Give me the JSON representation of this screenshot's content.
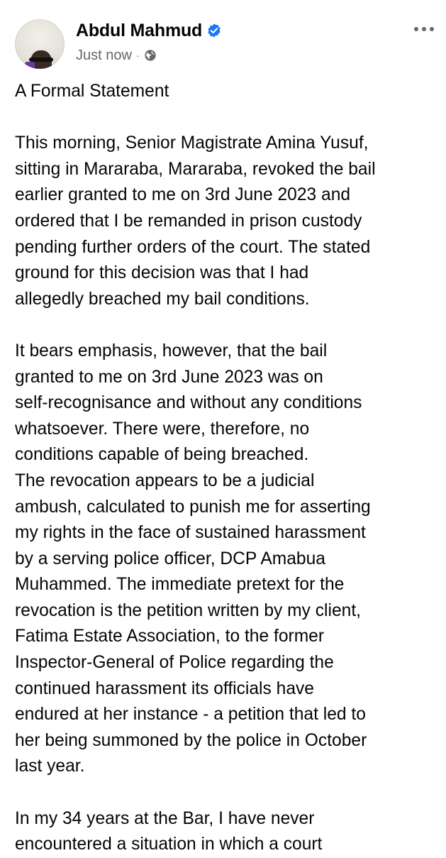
{
  "post": {
    "author": {
      "name": "Abdul Mahmud",
      "verified": true,
      "verified_icon": "verified-badge-icon",
      "verified_color": "#1877f2"
    },
    "meta": {
      "time": "Just now",
      "separator": "·",
      "audience_icon": "globe-icon"
    },
    "more_icon": "more-options-icon",
    "body": {
      "title": "A Formal Statement",
      "paragraph1": [
        "This morning, Senior Magistrate Amina Yusuf,",
        "sitting in Mararaba, Mararaba, revoked the bail",
        "earlier granted to me on 3rd June 2023 and",
        "ordered that I be remanded in prison custody",
        "pending further orders of the court. The stated",
        "ground for this decision was that I had",
        "allegedly breached my bail conditions."
      ],
      "paragraph2": [
        "It bears emphasis, however, that the bail",
        "granted to me on 3rd June 2023 was on",
        "self-recognisance and without any conditions",
        "whatsoever. There were, therefore, no",
        "conditions capable of being breached.",
        "The revocation appears to be a judicial",
        "ambush, calculated to punish me for asserting",
        "my rights in the face of sustained harassment",
        "by a serving police officer, DCP Amabua",
        "Muhammed. The immediate pretext for the",
        "revocation is the petition written by my client,",
        "Fatima Estate Association, to the former",
        "Inspector-General of Police regarding the",
        "continued harassment its officials have",
        "endured at her instance - a petition that led to",
        "her being summoned by the police in October",
        "last year."
      ],
      "paragraph3": [
        "In my 34 years at the Bar, I have never",
        "encountered a situation in which a court"
      ]
    }
  }
}
